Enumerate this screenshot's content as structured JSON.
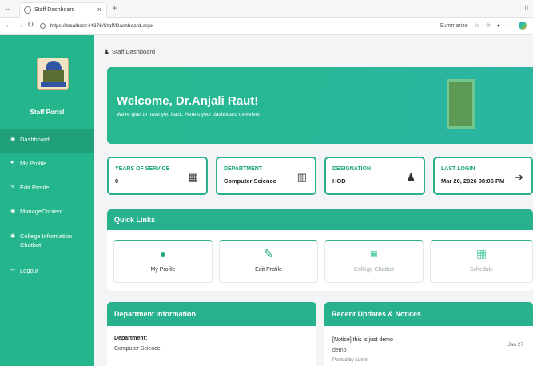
{
  "browser": {
    "tab_title": "Staff Dashboard",
    "tab_close": "×",
    "new_tab": "+",
    "url": "https://localhost:44376/Staff/Dashboard.aspx",
    "summarize": "Summarize"
  },
  "sidebar": {
    "portal_title": "Staff Portal",
    "items": [
      {
        "label": "Dashboard",
        "icon": "dashboard-icon",
        "glyph": "◉"
      },
      {
        "label": "My Profile",
        "icon": "user-icon",
        "glyph": "●"
      },
      {
        "label": "Edit Profile",
        "icon": "edit-icon",
        "glyph": "✎"
      },
      {
        "label": "ManageContent",
        "icon": "content-icon",
        "glyph": "◉"
      },
      {
        "label": "College Information Chatbot",
        "icon": "chatbot-icon",
        "glyph": "◉"
      },
      {
        "label": "Logout",
        "icon": "logout-icon",
        "glyph": "↪"
      }
    ]
  },
  "breadcrumb": "Staff Dashboard",
  "hero": {
    "title": "Welcome, Dr.Anjali Raut!",
    "subtitle": "We're glad to have you back. Here's your dashboard overview."
  },
  "stats": [
    {
      "label": "YEARS OF SERVICE",
      "value": "0",
      "icon": "calendar-icon",
      "glyph": "▦"
    },
    {
      "label": "DEPARTMENT",
      "value": "Computer Science",
      "icon": "building-icon",
      "glyph": "▥"
    },
    {
      "label": "DESIGNATION",
      "value": "HOD",
      "icon": "user-tie-icon",
      "glyph": "♟"
    },
    {
      "label": "LAST LOGIN",
      "value": "Mar 20, 2026 08:06 PM",
      "icon": "sign-in-icon",
      "glyph": "➔"
    }
  ],
  "quick_links": {
    "title": "Quick Links",
    "items": [
      {
        "label": "My Profile",
        "icon": "user-icon",
        "glyph": "●"
      },
      {
        "label": "Edit Profile",
        "icon": "edit-icon",
        "glyph": "✎"
      },
      {
        "label": "College Chatbot",
        "icon": "robot-icon",
        "glyph": "◙"
      },
      {
        "label": "Schedule",
        "icon": "calendar-icon",
        "glyph": "▦"
      }
    ]
  },
  "department_panel": {
    "title": "Department Information",
    "dept_label": "Department:",
    "dept_value": "Computer Science"
  },
  "notices_panel": {
    "title": "Recent Updates & Notices",
    "notice_title": "[Notice] this is just demo",
    "notice_date": "Jan 27",
    "notice_desc": "demo",
    "notice_by": "Posted by Admin"
  },
  "colors": {
    "brand": "#24b58c",
    "sidebar_active": "#1fa07b"
  }
}
